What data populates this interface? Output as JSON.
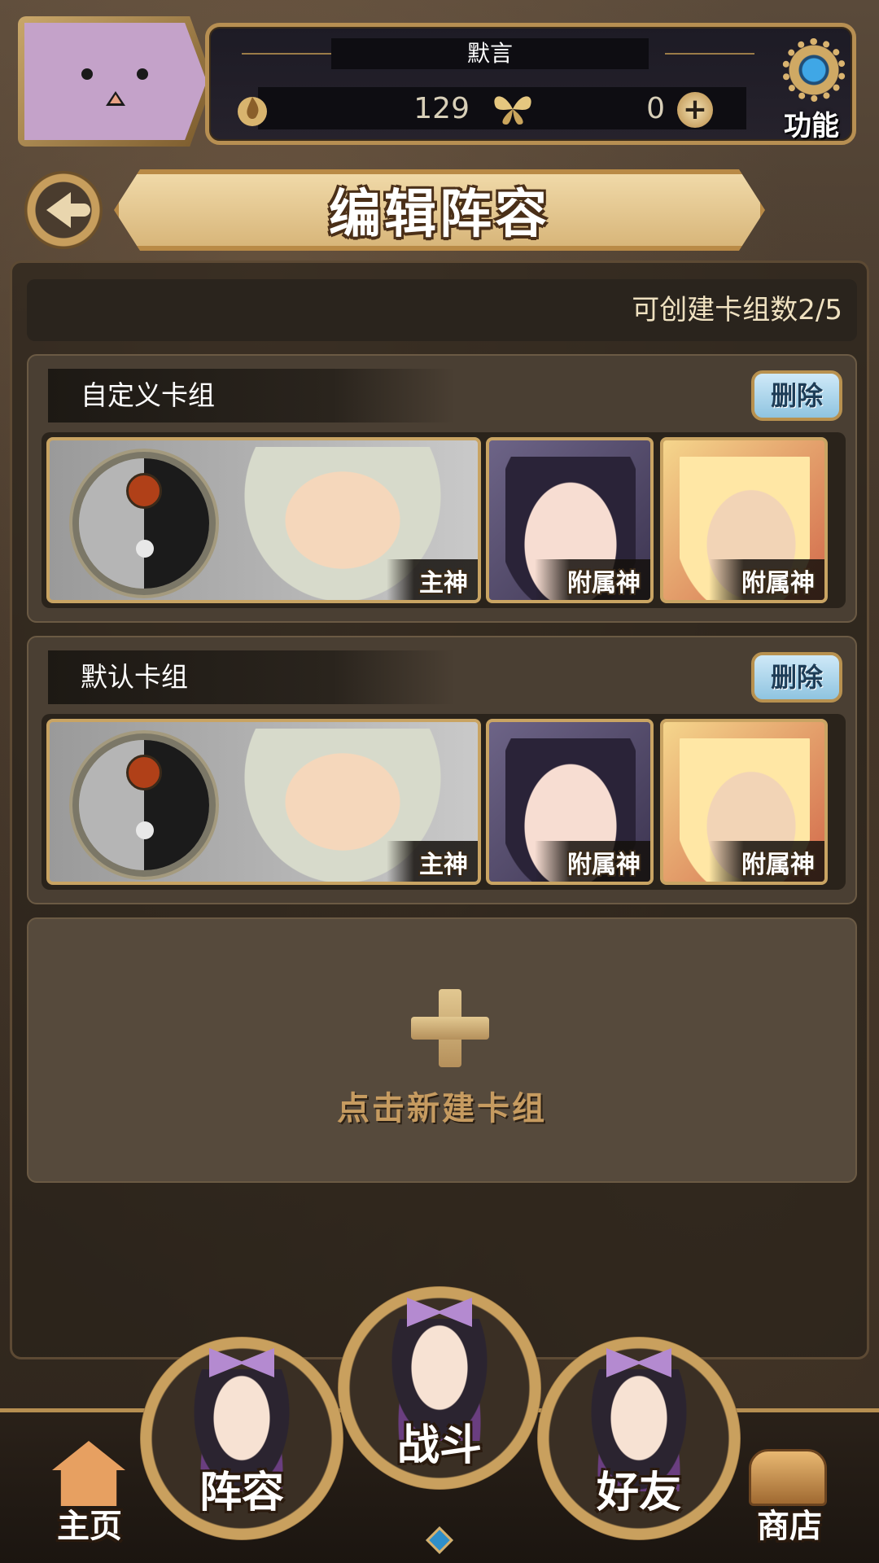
{
  "header": {
    "player_name": "默言",
    "coins": "129",
    "gems": "0",
    "function_label": "功能"
  },
  "title": "编辑阵容",
  "deck_count_text": "可创建卡组数2/5",
  "decks": [
    {
      "name": "自定义卡组",
      "delete_label": "删除",
      "cards": [
        {
          "role": "主神"
        },
        {
          "role": "附属神"
        },
        {
          "role": "附属神"
        }
      ]
    },
    {
      "name": "默认卡组",
      "delete_label": "删除",
      "cards": [
        {
          "role": "主神"
        },
        {
          "role": "附属神"
        },
        {
          "role": "附属神"
        }
      ]
    }
  ],
  "new_deck_label": "点击新建卡组",
  "nav": {
    "home": "主页",
    "team": "阵容",
    "battle": "战斗",
    "friends": "好友",
    "shop": "商店"
  },
  "icons": [
    "back-arrow-icon",
    "flame-coin-icon",
    "butterfly-icon",
    "plus-icon",
    "gear-icon",
    "yinyang-icon",
    "house-icon",
    "chest-icon"
  ],
  "colors": {
    "gold_border": "#b78f52",
    "delete_button": "#8fc4e0",
    "accent_gem": "#2f8fc9"
  }
}
